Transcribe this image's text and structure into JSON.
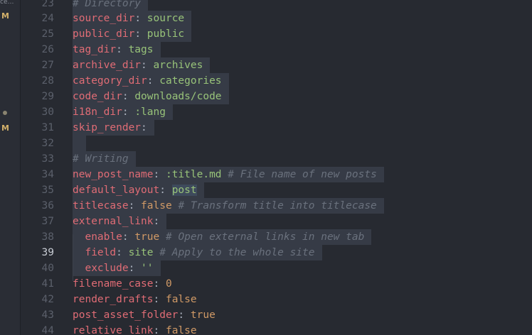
{
  "sidebar": {
    "top_text": "ce…",
    "markers": [
      {
        "type": "M",
        "line": 24
      },
      {
        "type": "dot",
        "line": 30
      },
      {
        "type": "M",
        "line": 31
      }
    ]
  },
  "editor": {
    "active_line": 39,
    "lines": [
      {
        "num": "23",
        "key": "",
        "value": "",
        "comment": "# Directory"
      },
      {
        "num": "24",
        "key": "source_dir",
        "value": "source"
      },
      {
        "num": "25",
        "key": "public_dir",
        "value": "public"
      },
      {
        "num": "26",
        "key": "tag_dir",
        "value": "tags"
      },
      {
        "num": "27",
        "key": "archive_dir",
        "value": "archives"
      },
      {
        "num": "28",
        "key": "category_dir",
        "value": "categories"
      },
      {
        "num": "29",
        "key": "code_dir",
        "value": "downloads/code"
      },
      {
        "num": "30",
        "key": "i18n_dir",
        "value": ":lang"
      },
      {
        "num": "31",
        "key": "skip_render",
        "value": ""
      },
      {
        "num": "32"
      },
      {
        "num": "33",
        "comment": "# Writing"
      },
      {
        "num": "34",
        "key": "new_post_name",
        "value": ":title.md",
        "comment": "# File name of new posts"
      },
      {
        "num": "35",
        "key": "default_layout",
        "value": "post"
      },
      {
        "num": "36",
        "key": "titlecase",
        "value": "false",
        "comment": "# Transform title into titlecase"
      },
      {
        "num": "37",
        "key": "external_link",
        "value": ""
      },
      {
        "num": "38",
        "key": "enable",
        "value": "true",
        "comment": "# Open external links in new tab"
      },
      {
        "num": "39",
        "key": "field",
        "value": "site",
        "comment": "# Apply to the whole site"
      },
      {
        "num": "40",
        "key": "exclude",
        "value": "''"
      },
      {
        "num": "41",
        "key": "filename_case",
        "value": "0"
      },
      {
        "num": "42",
        "key": "render_drafts",
        "value": "false"
      },
      {
        "num": "43",
        "key": "post_asset_folder",
        "value": "true"
      },
      {
        "num": "44",
        "key": "relative_link",
        "value": "false"
      }
    ]
  },
  "colors": {
    "background": "#272a31",
    "key": "#e06c75",
    "string": "#98c379",
    "number": "#d19a66",
    "comment": "#6a717d",
    "selection": "#363b46"
  }
}
